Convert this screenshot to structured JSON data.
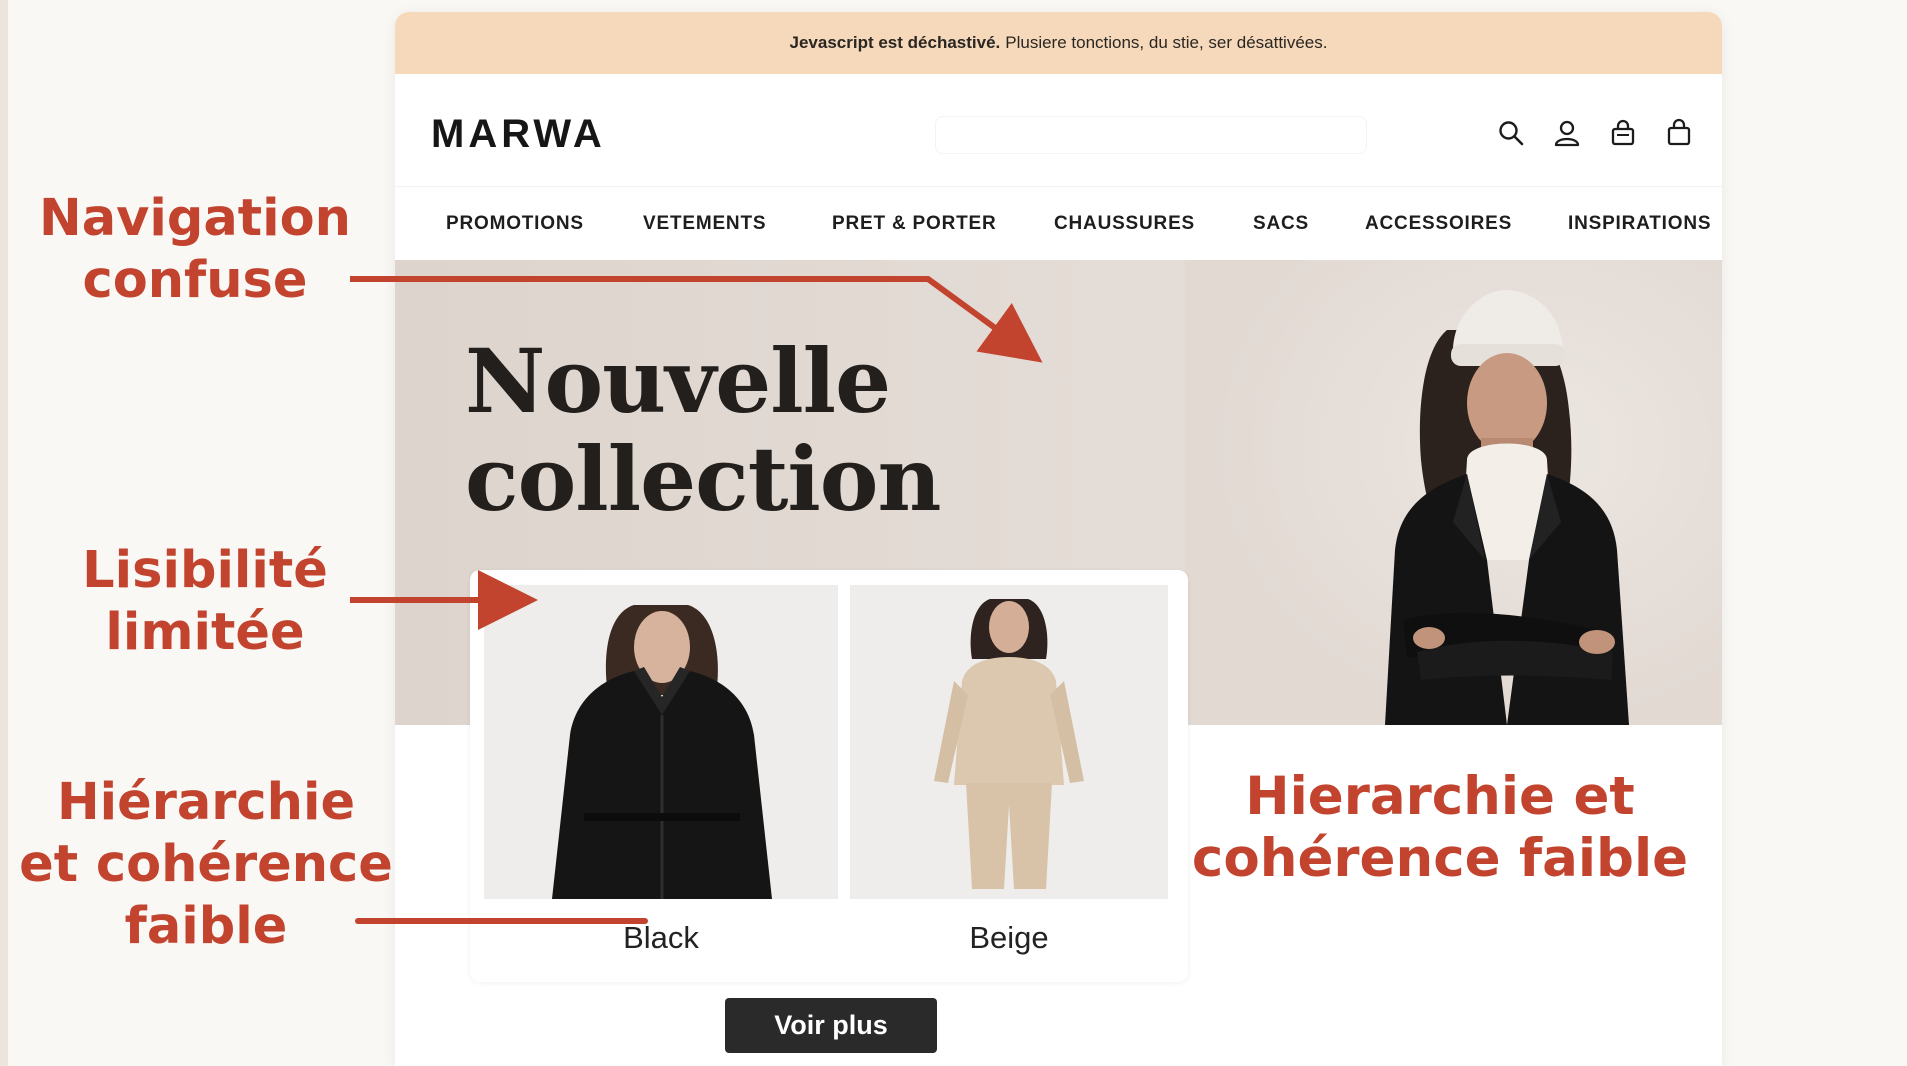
{
  "banner": {
    "strong": "Jevascript est déchastivé.",
    "text": "Plusiere tonctions, du stie, ser désattivées."
  },
  "header": {
    "logo": "MARWA",
    "icons": [
      "search-icon",
      "user-icon",
      "bag-icon",
      "cart-icon"
    ]
  },
  "nav": {
    "items": [
      "PROMOTIONS",
      "VETEMENTS",
      "PRET & PORTER",
      "CHAUSSURES",
      "SACS",
      "ACCESSOIRES",
      "INSPIRATIONS"
    ]
  },
  "hero": {
    "title_line1": "Nouvelle",
    "title_line2": "collection"
  },
  "products": [
    {
      "label": "Black"
    },
    {
      "label": "Beige"
    }
  ],
  "cta": {
    "label": "Voir plus"
  },
  "annotations": {
    "navigation": {
      "line1": "Navigation",
      "line2": "confuse"
    },
    "legibility": {
      "line1": "Lisibilité",
      "line2": "limitée"
    },
    "hierarchy_left": {
      "line1": "Hiérarchie",
      "line2": "et cohérence",
      "line3": "faible"
    },
    "hierarchy_right": {
      "line1": "Hierarchie et",
      "line2": "cohérence faible"
    }
  },
  "colors": {
    "annotation": "#c2432e",
    "banner": "#f6d9bb",
    "cta": "#2a2a2a"
  }
}
